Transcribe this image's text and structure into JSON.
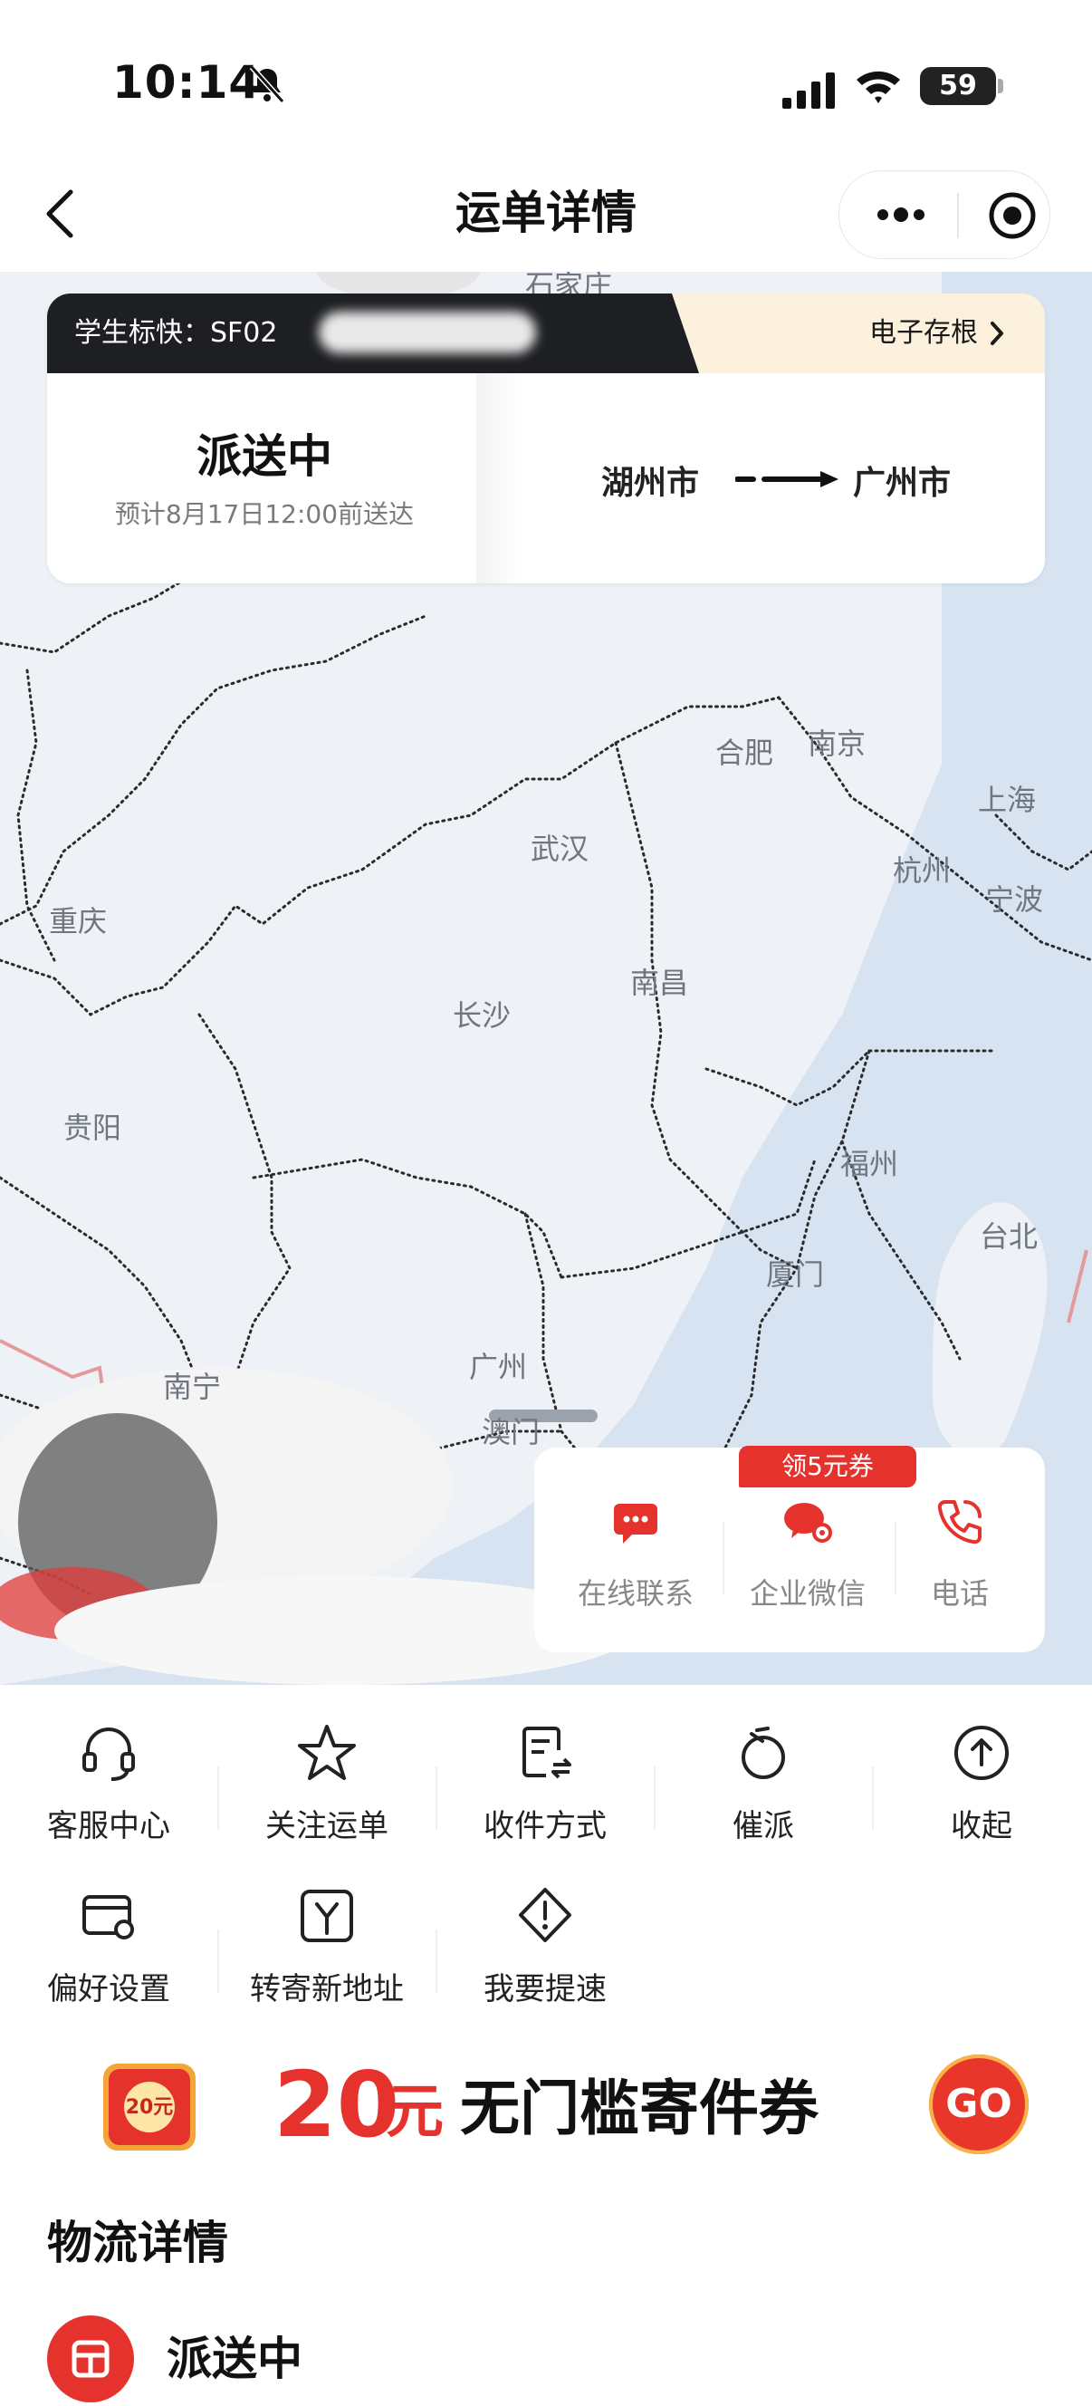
{
  "status_bar": {
    "time": "10:14",
    "battery": "59"
  },
  "nav": {
    "title": "运单详情"
  },
  "map": {
    "cities": [
      {
        "name": "石家庄"
      },
      {
        "name": "合肥"
      },
      {
        "name": "南京"
      },
      {
        "name": "上海"
      },
      {
        "name": "武汉"
      },
      {
        "name": "杭州"
      },
      {
        "name": "宁波"
      },
      {
        "name": "重庆"
      },
      {
        "name": "南昌"
      },
      {
        "name": "长沙"
      },
      {
        "name": "贵阳"
      },
      {
        "name": "福州"
      },
      {
        "name": "台北"
      },
      {
        "name": "厦门"
      },
      {
        "name": "广州"
      },
      {
        "name": "南宁"
      },
      {
        "name": "澳门"
      }
    ]
  },
  "shipment": {
    "number": "学生标快：SF02",
    "archive_label": "电子存根",
    "status": "派送中",
    "eta": "预计8月17日12:00前送达",
    "from": "湖州市",
    "to": "广州市"
  },
  "contact": {
    "badge": "领5元券",
    "items": [
      {
        "label": "在线联系"
      },
      {
        "label": "企业微信"
      },
      {
        "label": "电话"
      }
    ]
  },
  "actions": [
    {
      "label": "客服中心"
    },
    {
      "label": "关注运单"
    },
    {
      "label": "收件方式"
    },
    {
      "label": "催派"
    },
    {
      "label": "收起"
    },
    {
      "label": "偏好设置"
    },
    {
      "label": "转寄新地址"
    },
    {
      "label": "我要提速"
    }
  ],
  "coupon": {
    "icon_text": "20元",
    "amount": "20",
    "unit": "元",
    "text": "无门槛寄件券",
    "go": "GO"
  },
  "logistics": {
    "title": "物流详情",
    "latest_status": "派送中"
  },
  "colors": {
    "accent": "#e5322d",
    "dark": "#1d1f22",
    "cream": "#fbf1dd"
  }
}
